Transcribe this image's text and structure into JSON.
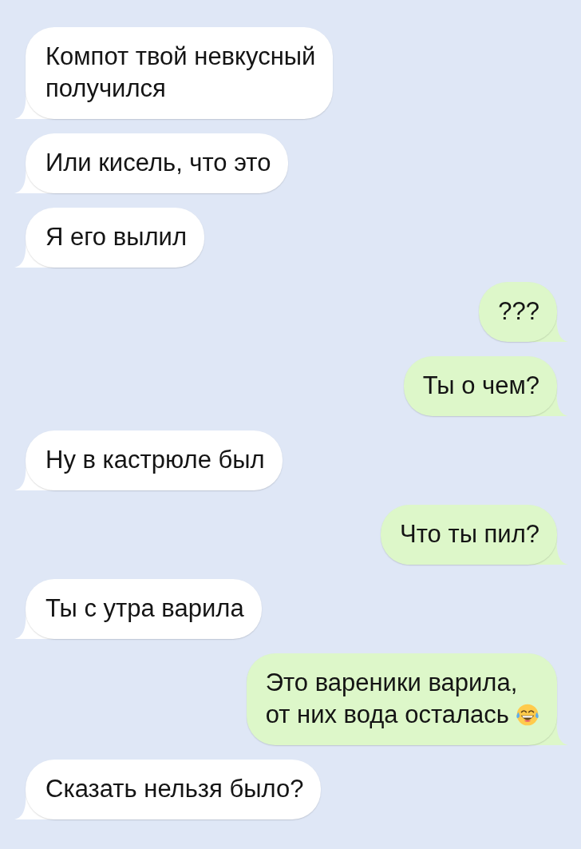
{
  "messages": [
    {
      "kind": "received",
      "text": "Компот твой невкусный\nполучился"
    },
    {
      "kind": "received",
      "text": "Или кисель, что это"
    },
    {
      "kind": "received",
      "text": "Я его вылил"
    },
    {
      "kind": "sent",
      "text": "???"
    },
    {
      "kind": "sent",
      "text": "Ты о чем?"
    },
    {
      "kind": "received",
      "text": "Ну в кастрюле был"
    },
    {
      "kind": "sent",
      "text": "Что ты пил?"
    },
    {
      "kind": "received",
      "text": "Ты с утра варила"
    },
    {
      "kind": "sent",
      "text": "Это вареники варила,\nот них вода осталась",
      "emoji": true
    },
    {
      "kind": "received",
      "text": "Сказать нельзя было?"
    }
  ]
}
